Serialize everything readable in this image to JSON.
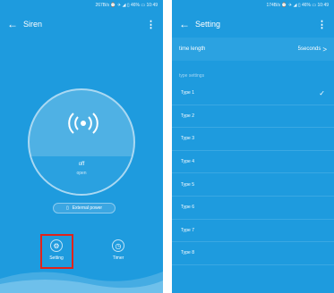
{
  "left": {
    "status": {
      "text": "267B/s ⌚ ✈ ◢ ▯ 46% ▭ 10:49"
    },
    "appbar": {
      "back": "←",
      "title": "Siren",
      "more": "⋮"
    },
    "state": {
      "main": "off",
      "sub": "open"
    },
    "external_power": {
      "label": "External power"
    },
    "bottom": {
      "setting": "Setting",
      "timer": "Timer"
    }
  },
  "right": {
    "status": {
      "text": "174B/s ⌚ ✈ ◢ ▯ 46% ▭ 10:49"
    },
    "appbar": {
      "back": "←",
      "title": "Setting",
      "more": "⋮"
    },
    "time_length": {
      "label": "time length",
      "value": "5seconds",
      "chevron": ">"
    },
    "section": "type settings",
    "types": [
      {
        "label": "Type 1",
        "selected": true,
        "check": "✓"
      },
      {
        "label": "Type 2"
      },
      {
        "label": "Type 3"
      },
      {
        "label": "Type 4"
      },
      {
        "label": "Type 5"
      },
      {
        "label": "Type 6"
      },
      {
        "label": "Type 7"
      },
      {
        "label": "Type 8"
      }
    ]
  },
  "colors": {
    "primary": "#1e9bde",
    "highlight": "#e2231a"
  }
}
